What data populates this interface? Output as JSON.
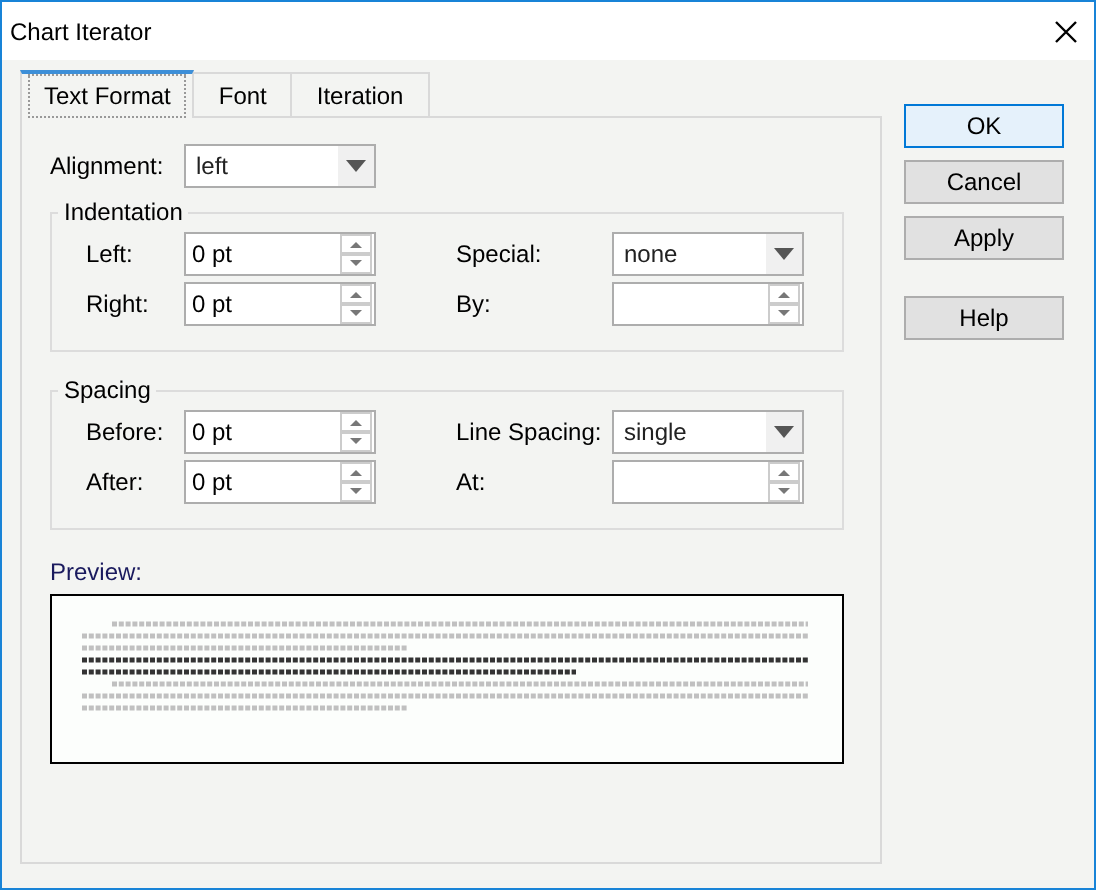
{
  "window": {
    "title": "Chart Iterator"
  },
  "tabs": [
    {
      "label": "Text Format",
      "selected": true
    },
    {
      "label": "Font",
      "selected": false
    },
    {
      "label": "Iteration",
      "selected": false
    }
  ],
  "alignment": {
    "label": "Alignment:",
    "value": "left"
  },
  "groups": [
    {
      "title": "Indentation",
      "fields": [
        {
          "kind": "spin",
          "label": "Left:",
          "value": "0 pt"
        },
        {
          "kind": "combo",
          "label": "Special:",
          "value": "none"
        },
        {
          "kind": "spin",
          "label": "Right:",
          "value": "0 pt"
        },
        {
          "kind": "spin",
          "label": "By:"
        }
      ]
    },
    {
      "title": "Spacing",
      "fields": [
        {
          "kind": "spin",
          "label": "Before:",
          "value": "0 pt"
        },
        {
          "kind": "combo",
          "label": "Line Spacing:",
          "value": "single"
        },
        {
          "kind": "spin",
          "label": "After:",
          "value": "0 pt"
        },
        {
          "kind": "spin",
          "label": "At:"
        }
      ]
    }
  ],
  "preview": {
    "label": "Preview:"
  },
  "buttons": [
    {
      "label": "OK",
      "default": true
    },
    {
      "label": "Cancel",
      "default": false
    },
    {
      "label": "Apply",
      "default": false
    },
    {
      "label": "Help",
      "default": false
    }
  ]
}
